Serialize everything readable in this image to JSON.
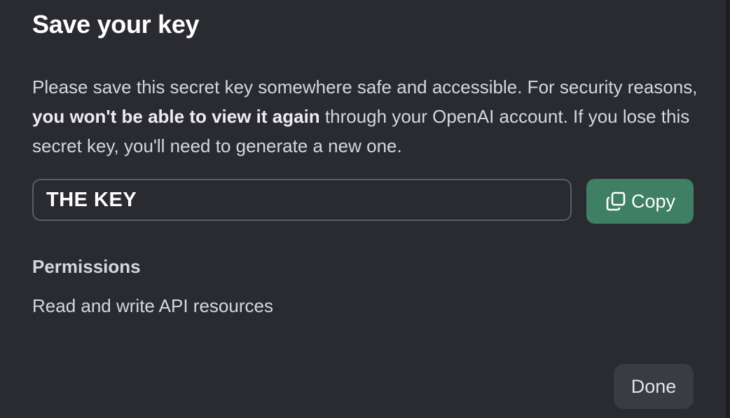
{
  "dialog": {
    "title": "Save your key",
    "description": {
      "part1": "Please save this secret key somewhere safe and accessible. For security reasons, ",
      "bold": "you won't be able to view it again",
      "part2": " through your OpenAI account. If you lose this secret key, you'll need to generate a new one."
    },
    "key_field": {
      "value": "THE KEY"
    },
    "copy_button": {
      "label": "Copy",
      "icon": "copy-icon",
      "color": "#3f7f63"
    },
    "permissions": {
      "title": "Permissions",
      "value": "Read and write API resources"
    },
    "done_button": {
      "label": "Done"
    }
  }
}
